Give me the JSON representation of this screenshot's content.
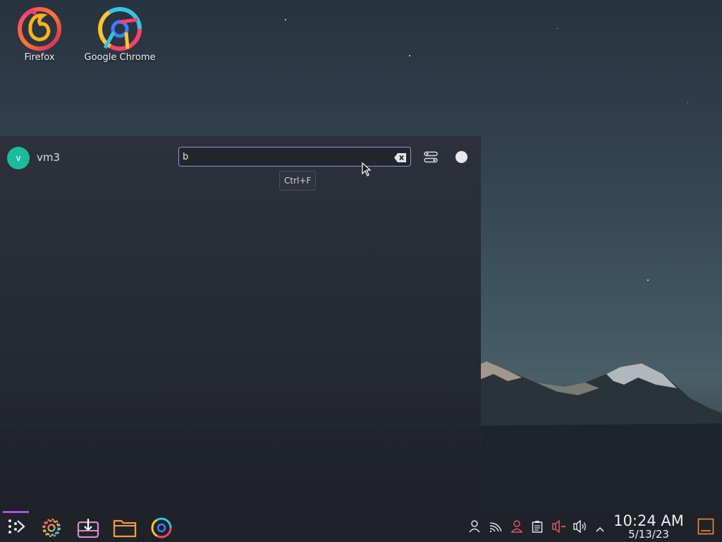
{
  "desktop": {
    "icons": [
      {
        "label": "Firefox",
        "icon": "firefox-icon"
      },
      {
        "label": "Google Chrome",
        "icon": "chrome-icon"
      }
    ]
  },
  "launcher": {
    "user": {
      "avatar_letter": "v",
      "name": "vm3"
    },
    "search": {
      "value": "b",
      "placeholder": ""
    },
    "tooltip": "Ctrl+F",
    "icons": [
      "clear-text-icon",
      "configure-icon",
      "power-icon"
    ]
  },
  "taskbar": {
    "apps": [
      "app-launcher-icon",
      "settings-icon",
      "discover-icon",
      "file-manager-icon",
      "chrome-icon"
    ],
    "tray": [
      "user-icon",
      "network-icon",
      "user-switcher-icon",
      "clipboard-icon",
      "microphone-muted-icon",
      "volume-icon",
      "expand-tray-icon",
      "show-desktop-icon"
    ],
    "clock": {
      "time": "10:24 AM",
      "date": "5/13/23"
    }
  },
  "colors": {
    "accent": "#9d8ee0",
    "avatar": "#1abc9c",
    "active_task_indicator": "#b04fd8",
    "muted_mic": "#e0566a"
  }
}
